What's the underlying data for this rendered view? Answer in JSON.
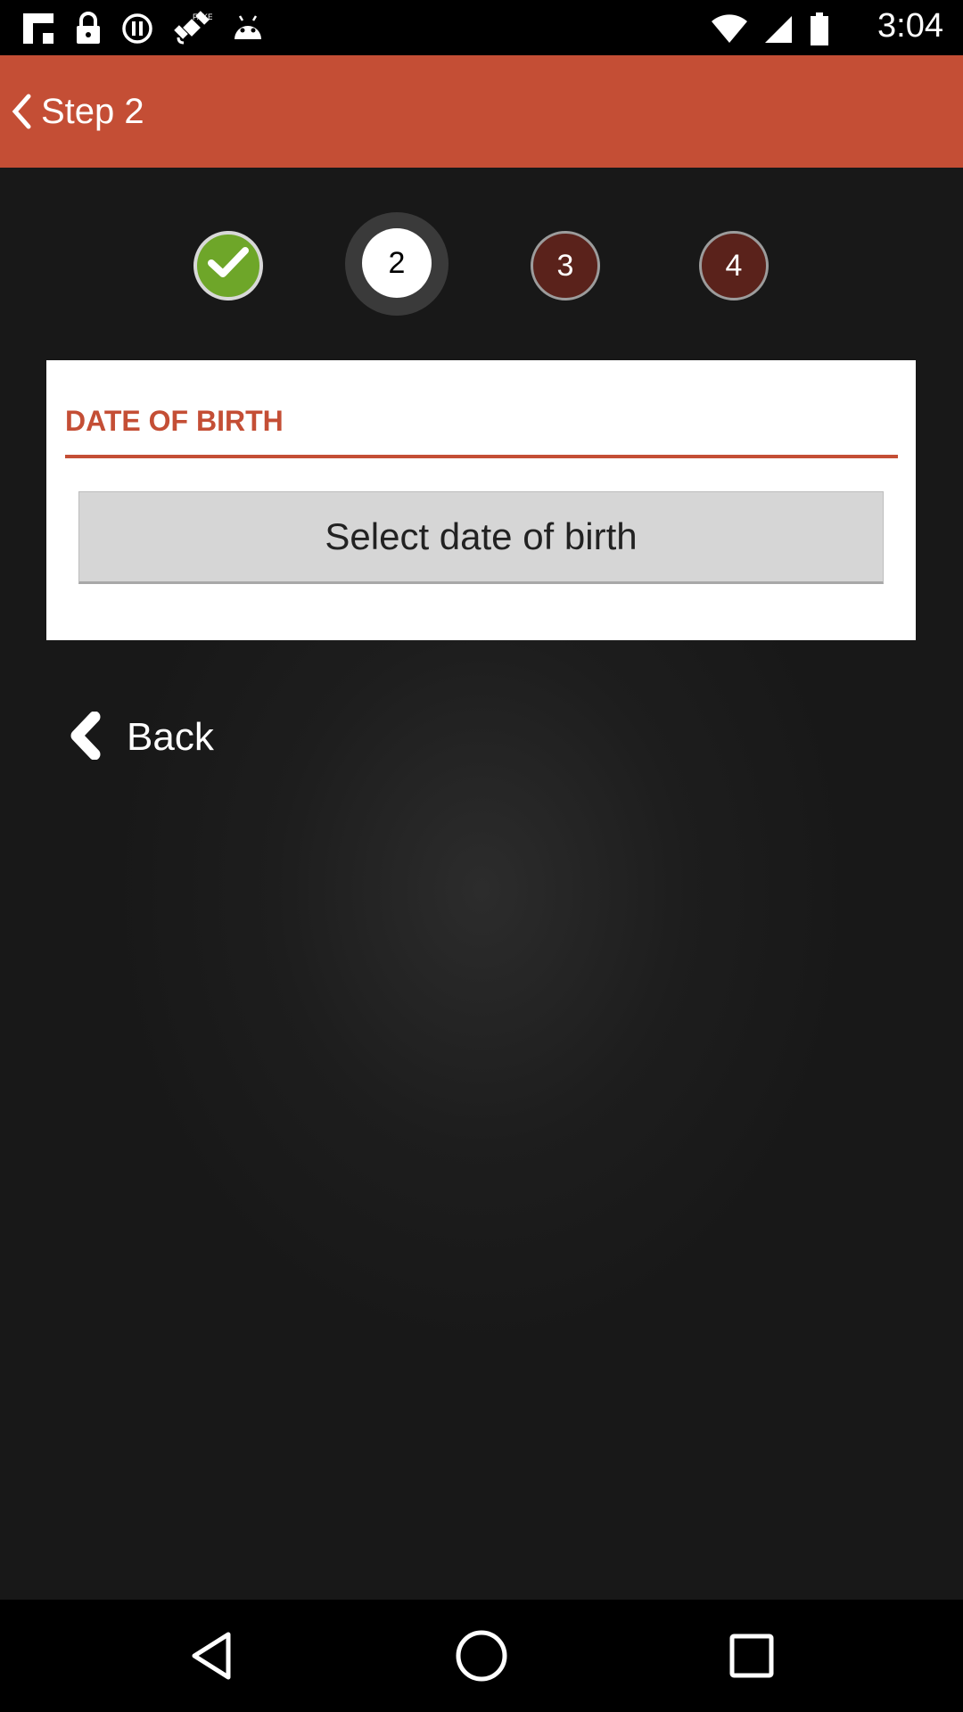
{
  "status_bar": {
    "time": "3:04",
    "left_icons": [
      "flipboard-icon",
      "lock-icon",
      "alert-icon",
      "satellite-fake-gps-icon",
      "android-icon"
    ]
  },
  "app_bar": {
    "title": "Step 2",
    "color": "#c44e35"
  },
  "stepper": {
    "steps": [
      {
        "label": "",
        "state": "done",
        "icon": "check-icon"
      },
      {
        "label": "2",
        "state": "current"
      },
      {
        "label": "3",
        "state": "pending"
      },
      {
        "label": "4",
        "state": "pending"
      }
    ]
  },
  "card": {
    "section_title": "DATE OF BIRTH",
    "select_button_label": "Select date of birth"
  },
  "back_link": {
    "label": "Back"
  },
  "nav_bar": {
    "buttons": [
      "back-triangle-icon",
      "home-circle-icon",
      "recents-square-icon"
    ]
  },
  "colors": {
    "accent": "#c44e35",
    "done_step": "#6ea629",
    "pending_step": "#5a221b"
  }
}
